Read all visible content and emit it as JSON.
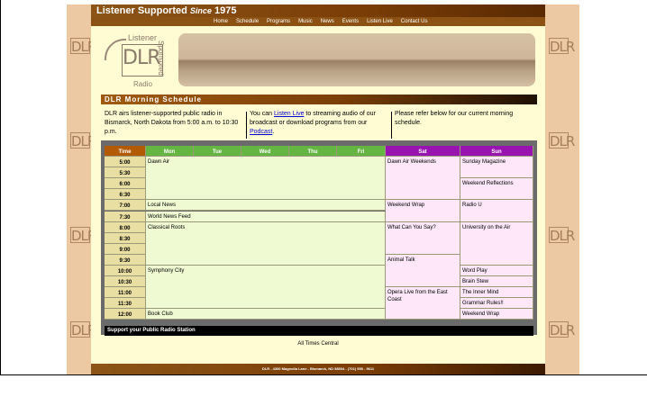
{
  "header": {
    "title": "Listener Supported",
    "since_word": "Since",
    "since_year": "1975"
  },
  "nav": [
    "Home",
    "Schedule",
    "Programs",
    "Music",
    "News",
    "Events",
    "Listen Live",
    "Contact Us"
  ],
  "logo": {
    "top_text": "Listener",
    "main_text": "DLR",
    "side_text": "Sponsored",
    "bottom_text": "Radio",
    "tile_text": "DLR"
  },
  "section_title": "DLR Morning Schedule",
  "info": {
    "col1": "DLR airs listener-supported public radio in Bismarck, North Dakota from 5:00 a.m. to 10:30 p.m.",
    "col2_before": "You can",
    "col2_link1": "Listen Live",
    "col2_middle": "to streaming audio of our broadcast or download programs from our",
    "col2_link2": "Podcast",
    "col2_after": ".",
    "col3": "Please refer below for our current morning schedule."
  },
  "schedule": {
    "headers": [
      "Time",
      "Mon",
      "Tue",
      "Wed",
      "Thu",
      "Fri",
      "Sat",
      "Sun"
    ],
    "header_colors": {
      "time": "#b35a07",
      "weekday": "#64b542",
      "weekend": "#9913b0"
    },
    "times": [
      "5:00",
      "5:30",
      "6:00",
      "6:30",
      "7:00",
      "7:30",
      "8:00",
      "8:30",
      "9:00",
      "9:30",
      "10:00",
      "10:30",
      "11:00",
      "11:30",
      "12:00"
    ],
    "weekday_blocks": [
      {
        "row": 0,
        "span": 4,
        "title": "Dawn Air"
      },
      {
        "row": 4,
        "span": 1,
        "title": "Local News"
      },
      {
        "row": 5,
        "span": 1,
        "title": "World News Feed"
      },
      {
        "row": 6,
        "span": 4,
        "title": "Classical Roots"
      },
      {
        "row": 10,
        "span": 4,
        "title": "Symphony City"
      },
      {
        "row": 14,
        "span": 1,
        "title": "Book Club"
      }
    ],
    "saturday_blocks": [
      {
        "row": 0,
        "span": 4,
        "title": "Dawn Air Weekends"
      },
      {
        "row": 4,
        "span": 2,
        "title": "Weekend Wrap"
      },
      {
        "row": 6,
        "span": 3,
        "title": "What Can You Say?"
      },
      {
        "row": 9,
        "span": 3,
        "title": "Animal Talk"
      },
      {
        "row": 12,
        "span": 3,
        "title": "Opera Live from the East Coast"
      }
    ],
    "sunday_blocks": [
      {
        "row": 0,
        "span": 2,
        "title": "Sunday Magazine"
      },
      {
        "row": 2,
        "span": 2,
        "title": "Weekend Reflections"
      },
      {
        "row": 4,
        "span": 2,
        "title": "Radio U"
      },
      {
        "row": 6,
        "span": 4,
        "title": "University on the Air"
      },
      {
        "row": 10,
        "span": 1,
        "title": "Word Play"
      },
      {
        "row": 11,
        "span": 1,
        "title": "Brain Stew"
      },
      {
        "row": 12,
        "span": 1,
        "title": "The Inner Mind"
      },
      {
        "row": 13,
        "span": 1,
        "title": "Grammar Rules!!"
      },
      {
        "row": 14,
        "span": 1,
        "title": "Weekend Wrap"
      }
    ],
    "footer": "Support your Public Radio Station"
  },
  "all_times": "All Times Central",
  "page_footer": "DLR - 4300 Magnolia Lane - Bismarck, ND 58504 - (701) 555 - 5611"
}
